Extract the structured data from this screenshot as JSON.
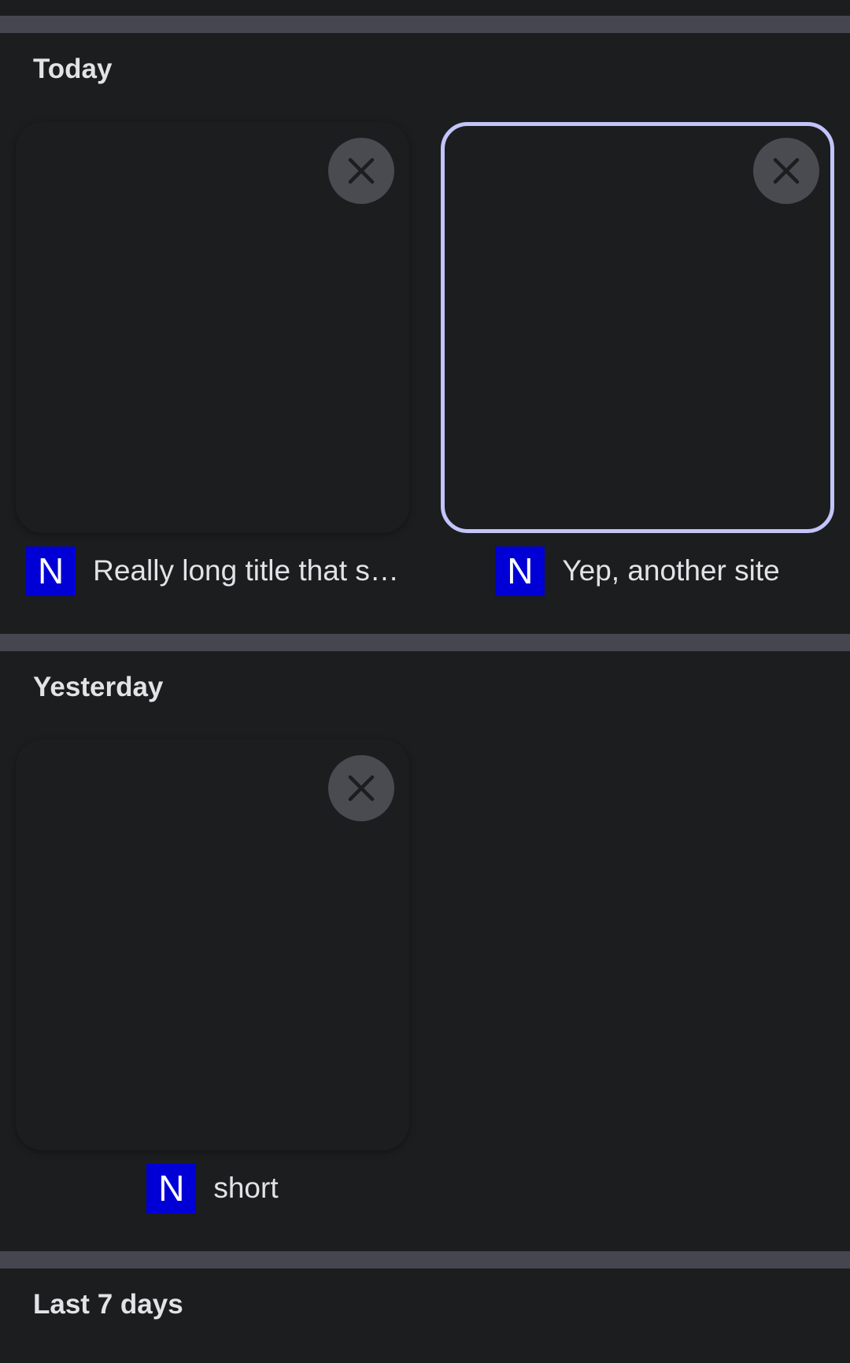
{
  "sections": [
    {
      "title": "Today",
      "tiles": [
        {
          "favicon_letter": "N",
          "title": "Really long title that s…",
          "selected": false
        },
        {
          "favicon_letter": "N",
          "title": "Yep, another site",
          "selected": true
        }
      ]
    },
    {
      "title": "Yesterday",
      "tiles": [
        {
          "favicon_letter": "N",
          "title": "short",
          "selected": false
        }
      ]
    },
    {
      "title": "Last 7 days",
      "tiles": []
    }
  ],
  "icons": {
    "close": "close-icon",
    "favicon": "site-favicon-icon"
  },
  "colors": {
    "background": "#1b1d1f",
    "divider": "#45464f",
    "selection_border": "#c2c4fa",
    "close_button_bg": "#4a4b50",
    "favicon_bg": "#0000d6",
    "text": "#e3e3e6"
  }
}
